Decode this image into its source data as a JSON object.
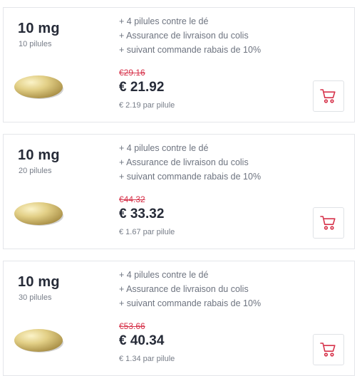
{
  "products": [
    {
      "dose": "10 mg",
      "quantity": "10 pilules",
      "features": [
        "+ 4 pilules contre le dé",
        "+ Assurance de livraison du colis",
        "+ suivant commande rabais de 10%"
      ],
      "old_price": "€29.16",
      "price": "€ 21.92",
      "unit_price": "€ 2.19 par pilule",
      "cart_icon": "shopping-cart-icon"
    },
    {
      "dose": "10 mg",
      "quantity": "20 pilules",
      "features": [
        "+ 4 pilules contre le dé",
        "+ Assurance de livraison du colis",
        "+ suivant commande rabais de 10%"
      ],
      "old_price": "€44.32",
      "price": "€ 33.32",
      "unit_price": "€ 1.67 par pilule",
      "cart_icon": "shopping-cart-icon"
    },
    {
      "dose": "10 mg",
      "quantity": "30 pilules",
      "features": [
        "+ 4 pilules contre le dé",
        "+ Assurance de livraison du colis",
        "+ suivant commande rabais de 10%"
      ],
      "old_price": "€53.66",
      "price": "€ 40.34",
      "unit_price": "€ 1.34 par pilule",
      "cart_icon": "shopping-cart-icon"
    }
  ],
  "colors": {
    "old_price": "#d6324a",
    "price": "#262b38",
    "border": "#e4e6ea",
    "pill_light": "#f3e6a8",
    "pill_dark": "#b8a052"
  }
}
